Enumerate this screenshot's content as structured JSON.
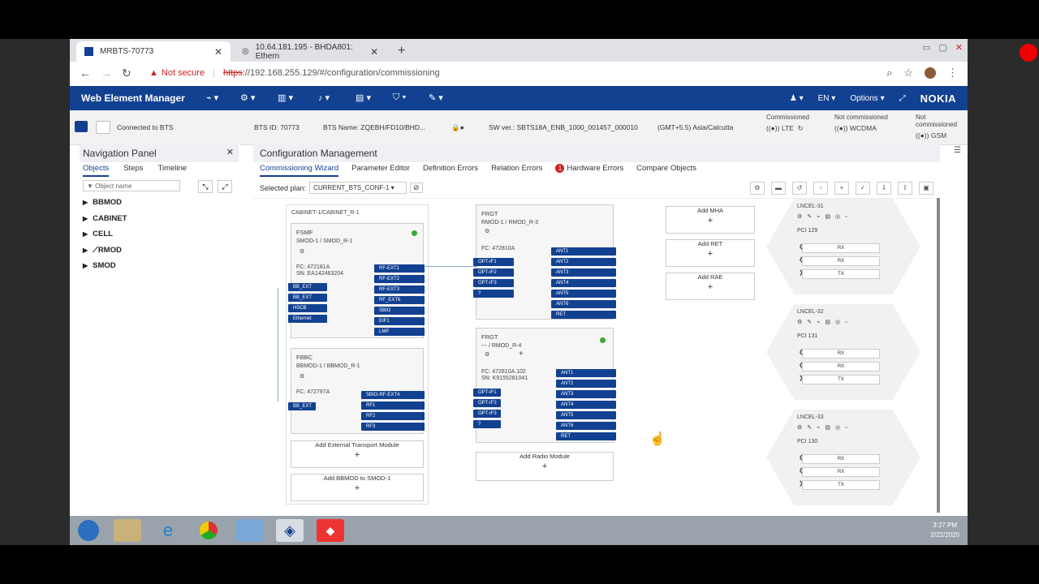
{
  "browser": {
    "tabs": [
      {
        "title": "MRBTS-70773",
        "active": true
      },
      {
        "title": "10.64.181.195 - BHDA801: Ethern",
        "active": false
      }
    ],
    "not_secure": "Not secure",
    "url_scheme": "https",
    "url_rest": "://192.168.255.129/#/configuration/commissioning"
  },
  "app": {
    "title": "Web Element Manager",
    "lang": "EN",
    "options": "Options",
    "brand": "NOKIA"
  },
  "status": {
    "connected": "Connected to BTS",
    "bts_id": "BTS ID: 70773",
    "bts_name": "BTS Name: ZQEBH/FD10/BHD...",
    "sw_ver": "SW ver.: SBTS18A_ENB_1000_001457_000010",
    "timezone": "(GMT+5.5) Asia/Calcutta",
    "modes": [
      {
        "state": "Commissioned",
        "tech": "LTE"
      },
      {
        "state": "Not commissioned",
        "tech": "WCDMA"
      },
      {
        "state": "Not commissioned",
        "tech": "GSM"
      }
    ]
  },
  "nav_panel": {
    "title": "Navigation Panel",
    "tabs": [
      "Objects",
      "Steps",
      "Timeline"
    ],
    "search_placeholder": "Object name",
    "tree": [
      "BBMOD",
      "CABINET",
      "CELL",
      "RMOD",
      "SMOD"
    ]
  },
  "config": {
    "title": "Configuration Management",
    "tabs": [
      "Commissioning Wizard",
      "Parameter Editor",
      "Definition Errors",
      "Relation Errors",
      "Hardware Errors",
      "Compare Objects"
    ],
    "hw_errors_count": "1",
    "plan_label": "Selected plan:",
    "plan_value": "CURRENT_BTS_CONF-1"
  },
  "diagram": {
    "cabinet_label": "CABINET-1/CABINET_R-1",
    "fsmf": {
      "type": "FSMF",
      "name": "SMOD-1 / SMOD_R-1",
      "fc": "FC: 472181A",
      "sn": "SN: EA142463204",
      "left_ports": [
        "BB_EXT",
        "BB_EXT",
        "HSCB",
        "Ethernet"
      ],
      "right_ports": [
        "RF-EXT1",
        "RF-EXT2",
        "RF-EXT3",
        "RF_EXT6",
        "SBIO",
        "EIF1",
        "LMP"
      ]
    },
    "fbbc": {
      "type": "FBBC",
      "name": "BBMOD-1 / BBMOD_R-1",
      "fc": "FC: 472797A",
      "left_ports": [
        "BB_EXT"
      ],
      "right_ports": [
        "SBIO-RF-EXT4",
        "RF1",
        "RF2",
        "RF3"
      ]
    },
    "add_transport": "Add External Transport Module",
    "add_bbmod": "Add BBMOD to SMOD-1",
    "frgt1": {
      "type": "FRGT",
      "name": "RMOD-1 / RMOD_R-3",
      "fc": "FC: 472810A",
      "opt_ports": [
        "OPT-IF1",
        "OPT-IF2",
        "OPT-IF3",
        "?"
      ],
      "ant_ports": [
        "ANT1",
        "ANT2",
        "ANT3",
        "ANT4",
        "ANT5",
        "ANT6",
        "RET"
      ]
    },
    "frgt2": {
      "type": "FRGT",
      "name": "--- / RMOD_R-4",
      "fc": "FC: 472810A.102",
      "sn": "SN: K9155281041",
      "opt_ports": [
        "OPT-IF1",
        "OPT-IF2",
        "OPT-IF3",
        "?"
      ],
      "ant_ports": [
        "ANT1",
        "ANT2",
        "ANT3",
        "ANT4",
        "ANT5",
        "ANT6",
        "RET"
      ]
    },
    "add_radio": "Add Radio Module",
    "add_mha": "Add MHA",
    "add_ret": "Add RET",
    "add_rae": "Add RAE",
    "cells": [
      {
        "name": "LNCEL-31",
        "pci": "PCI 129",
        "rows": [
          "RX",
          "RX",
          "TX"
        ]
      },
      {
        "name": "LNCEL-32",
        "pci": "PCI 131",
        "rows": [
          "RX",
          "RX",
          "TX"
        ]
      },
      {
        "name": "LNCEL-33",
        "pci": "PCI 130",
        "rows": [
          "RX",
          "RX",
          "TX"
        ]
      }
    ]
  },
  "taskbar": {
    "time": "3:27 PM",
    "date": "2/22/2020"
  }
}
